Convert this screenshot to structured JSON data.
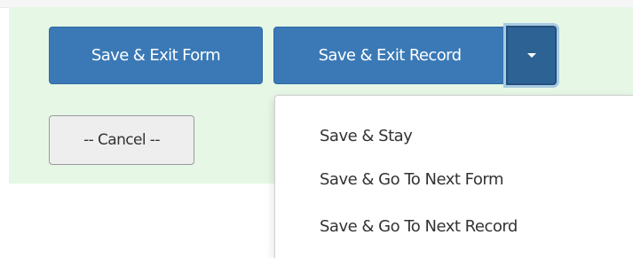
{
  "buttons": {
    "save_exit_form": "Save & Exit Form",
    "save_exit_record": "Save & Exit Record",
    "cancel": "-- Cancel --"
  },
  "dropdown": {
    "toggle_icon": "caret-down-icon",
    "items": [
      {
        "label": "Save & Stay"
      },
      {
        "label": "Save & Go To Next Form"
      },
      {
        "label": "Save & Go To Next Record"
      }
    ]
  },
  "colors": {
    "panel_background": "#e6f7e6",
    "primary_button": "#3a79b6",
    "primary_button_active": "#2d6294",
    "focus_ring": "#a8cbe3",
    "default_button": "#eeeeee",
    "menu_text": "#333333"
  }
}
